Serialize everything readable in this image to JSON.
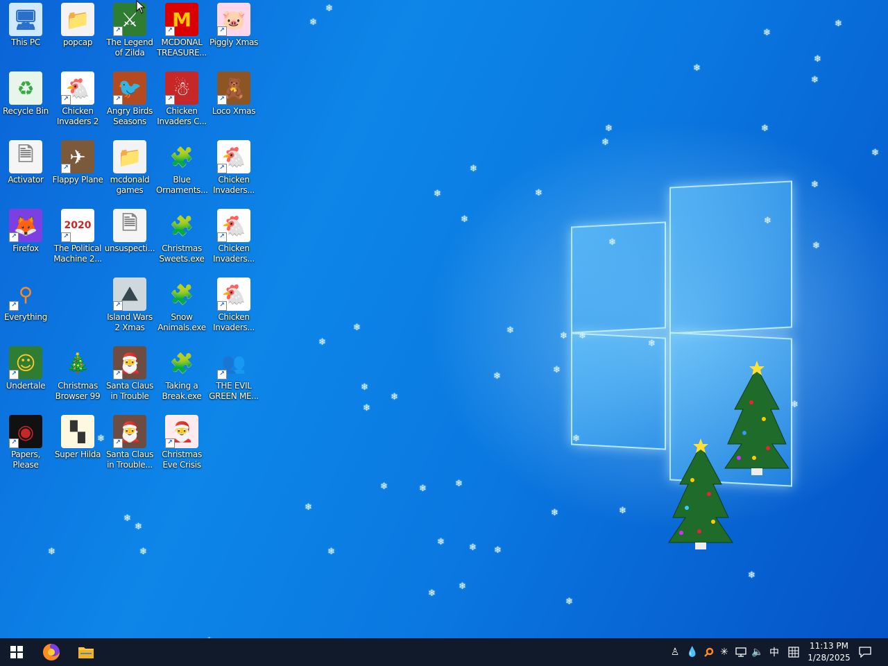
{
  "desktop": {
    "icons": [
      {
        "label": "This PC",
        "icon": "computer-icon",
        "shortcut": false
      },
      {
        "label": "popcap",
        "icon": "folder-icon",
        "shortcut": false
      },
      {
        "label": "The Legend of Zilda",
        "icon": "game-icon",
        "shortcut": true
      },
      {
        "label": "MCDONAL TREASURE...",
        "icon": "mcdonalds-icon",
        "shortcut": true
      },
      {
        "label": "Piggly Xmas",
        "icon": "pig-icon",
        "shortcut": true
      },
      {
        "label": "Recycle Bin",
        "icon": "recycle-bin-icon",
        "shortcut": false
      },
      {
        "label": "Chicken Invaders 2",
        "icon": "chicken-icon",
        "shortcut": true
      },
      {
        "label": "Angry Birds Seasons",
        "icon": "angry-bird-icon",
        "shortcut": true
      },
      {
        "label": "Chicken Invaders C...",
        "icon": "snowman-icon",
        "shortcut": true
      },
      {
        "label": "Loco Xmas",
        "icon": "bear-icon",
        "shortcut": true
      },
      {
        "label": "Activator",
        "icon": "file-icon",
        "shortcut": false
      },
      {
        "label": "Flappy Plane",
        "icon": "plane-icon",
        "shortcut": true
      },
      {
        "label": "mcdonald games",
        "icon": "folder-icon",
        "shortcut": false
      },
      {
        "label": "Blue Ornaments...",
        "icon": "puzzle-icon",
        "shortcut": false
      },
      {
        "label": "Chicken Invaders...",
        "icon": "chicken-icon",
        "shortcut": true
      },
      {
        "label": "Firefox",
        "icon": "firefox-icon",
        "shortcut": true
      },
      {
        "label": "The Political Machine 2...",
        "icon": "election-icon",
        "shortcut": true
      },
      {
        "label": "unsuspecti...",
        "icon": "file-icon",
        "shortcut": false
      },
      {
        "label": "Christmas Sweets.exe",
        "icon": "puzzle-icon",
        "shortcut": false
      },
      {
        "label": "Chicken Invaders...",
        "icon": "chicken-icon",
        "shortcut": true
      },
      {
        "label": "Everything",
        "icon": "magnifier-icon",
        "shortcut": true
      },
      {
        "label": "Island Wars 2 Xmas",
        "icon": "island-icon",
        "shortcut": true
      },
      {
        "label": "Snow Animals.exe",
        "icon": "puzzle-icon",
        "shortcut": false
      },
      {
        "label": "Chicken Invaders...",
        "icon": "chicken-icon",
        "shortcut": true
      },
      {
        "label": "Undertale",
        "icon": "undertale-icon",
        "shortcut": true
      },
      {
        "label": "Christmas Browser 99",
        "icon": "xmas-tree-icon",
        "shortcut": false
      },
      {
        "label": "Santa Claus in Trouble",
        "icon": "santa-icon",
        "shortcut": true
      },
      {
        "label": "Taking a Break.exe",
        "icon": "puzzle-icon",
        "shortcut": false
      },
      {
        "label": "THE EVIL GREEN ME...",
        "icon": "messenger-icon",
        "shortcut": true
      },
      {
        "label": "Papers, Please",
        "icon": "papers-please-icon",
        "shortcut": true
      },
      {
        "label": "Super Hilda",
        "icon": "pixel-game-icon",
        "shortcut": false
      },
      {
        "label": "Santa Claus in Trouble...",
        "icon": "santa-icon",
        "shortcut": true
      },
      {
        "label": "Christmas Eve Crisis",
        "icon": "santa-face-icon",
        "shortcut": true
      }
    ]
  },
  "taskbar": {
    "pinned": [
      {
        "name": "start-button",
        "icon": "windows-logo-icon"
      },
      {
        "name": "taskbar-firefox",
        "icon": "firefox-icon"
      },
      {
        "name": "taskbar-file-explorer",
        "icon": "folder-icon"
      }
    ],
    "tray": {
      "ime": "中",
      "time": "11:13 PM",
      "date": "1/28/2025"
    }
  },
  "colors": {
    "desktop_blue": "#0a78e0",
    "taskbar_bg": "#101a2a"
  }
}
